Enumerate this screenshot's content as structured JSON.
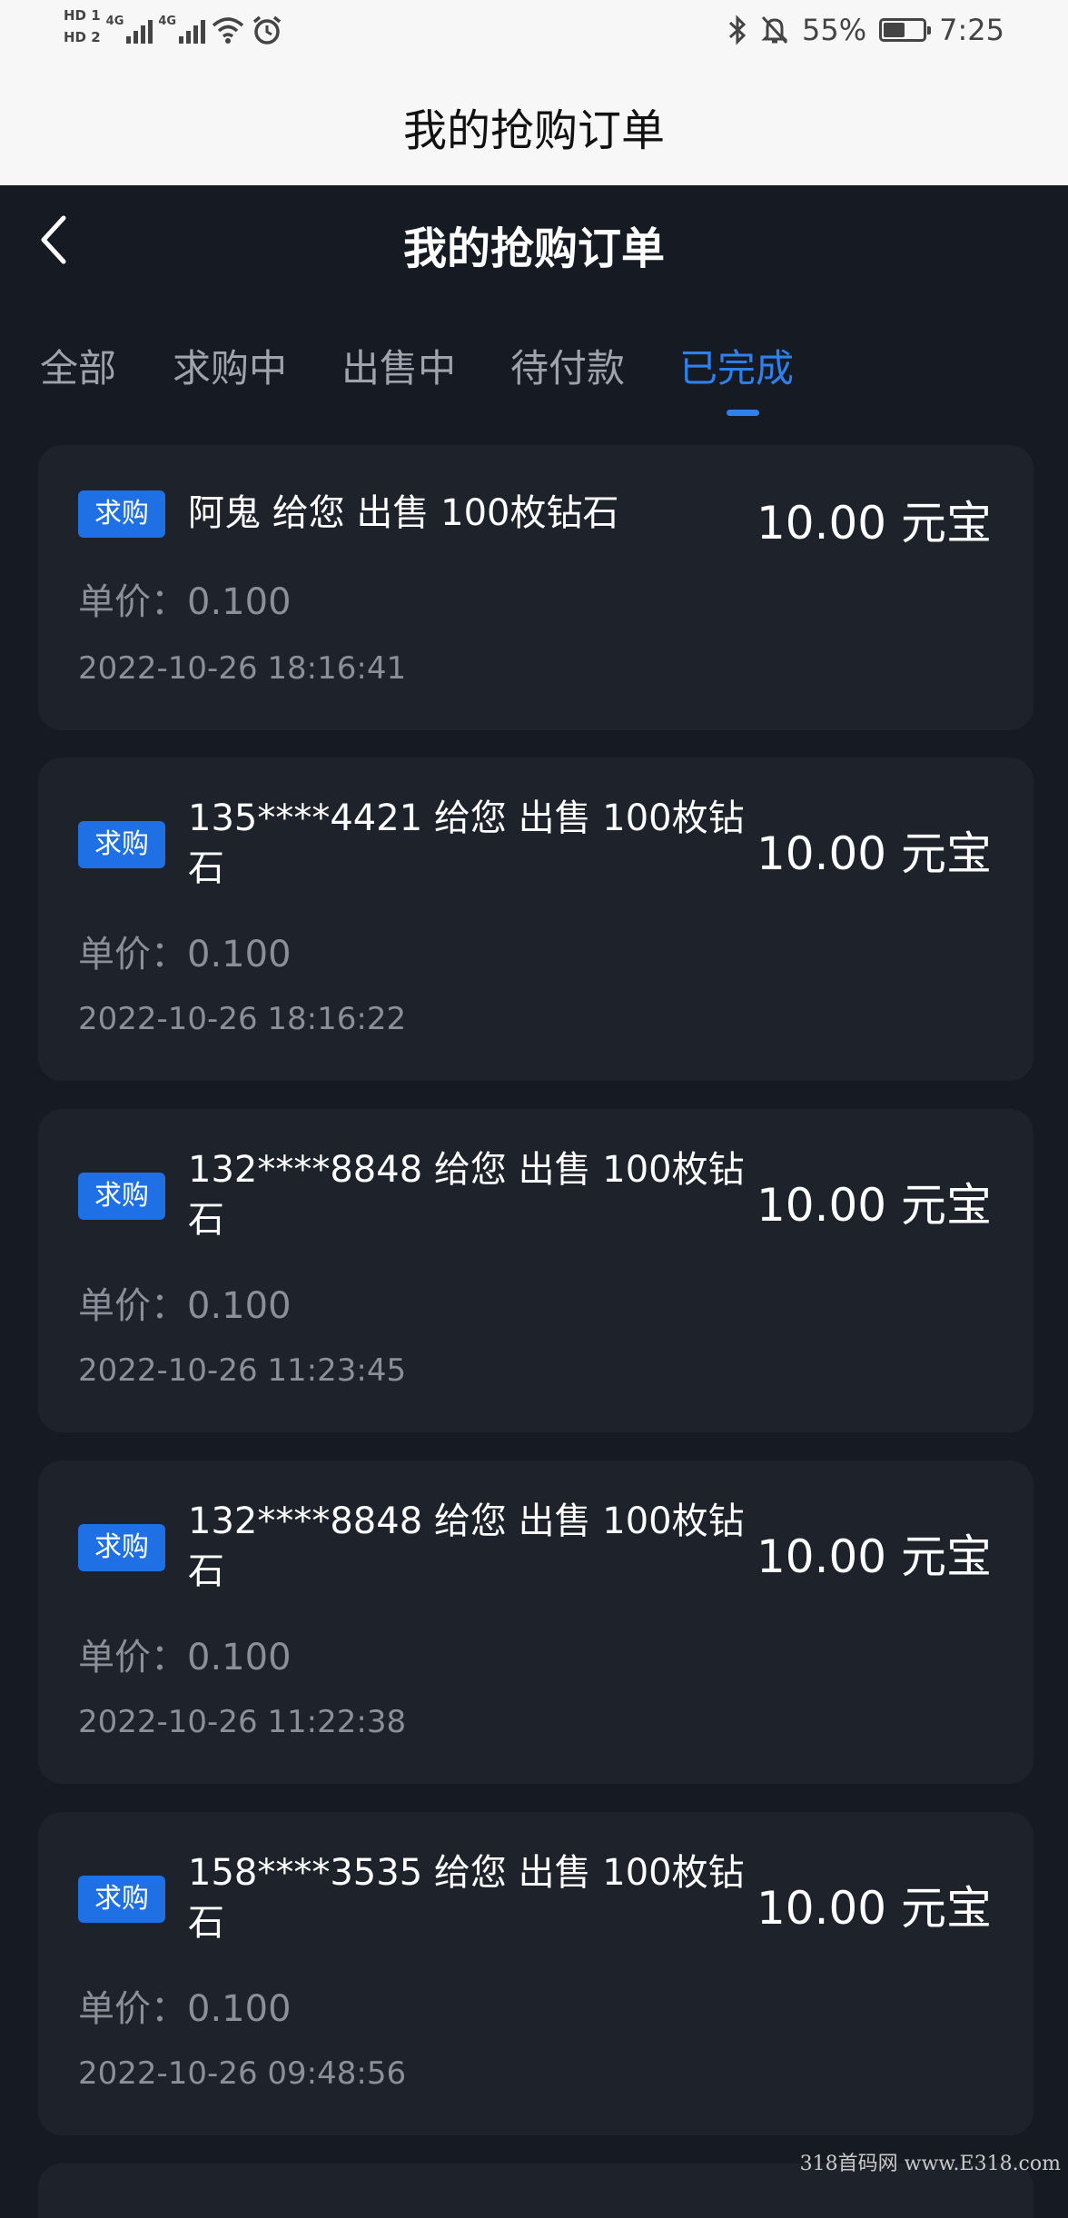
{
  "status_bar": {
    "hd1": "HD 1",
    "hd2": "HD 2",
    "net1": "4G",
    "net2": "4G",
    "battery_percent_text": "55%",
    "battery_level": 0.55,
    "time": "7:25"
  },
  "title_bar": {
    "title": "我的抢购订单"
  },
  "header": {
    "title": "我的抢购订单",
    "back_icon": "chevron-left-icon"
  },
  "tabs": [
    {
      "label": "全部",
      "active": false
    },
    {
      "label": "求购中",
      "active": false
    },
    {
      "label": "出售中",
      "active": false
    },
    {
      "label": "待付款",
      "active": false
    },
    {
      "label": "已完成",
      "active": true
    }
  ],
  "orders": [
    {
      "badge": "求购",
      "title": "阿鬼 给您 出售 100枚钻石",
      "amount": "10.00 元宝",
      "price_label": "单价：",
      "price": "0.100",
      "timestamp": "2022-10-26 18:16:41"
    },
    {
      "badge": "求购",
      "title": "135****4421 给您 出售 100枚钻石",
      "amount": "10.00 元宝",
      "price_label": "单价：",
      "price": "0.100",
      "timestamp": "2022-10-26 18:16:22"
    },
    {
      "badge": "求购",
      "title": "132****8848 给您 出售 100枚钻石",
      "amount": "10.00 元宝",
      "price_label": "单价：",
      "price": "0.100",
      "timestamp": "2022-10-26 11:23:45"
    },
    {
      "badge": "求购",
      "title": "132****8848 给您 出售 100枚钻石",
      "amount": "10.00 元宝",
      "price_label": "单价：",
      "price": "0.100",
      "timestamp": "2022-10-26 11:22:38"
    },
    {
      "badge": "求购",
      "title": "158****3535 给您 出售 100枚钻石",
      "amount": "10.00 元宝",
      "price_label": "单价：",
      "price": "0.100",
      "timestamp": "2022-10-26 09:48:56"
    }
  ],
  "watermark": "318首码网 www.E318.com",
  "colors": {
    "background": "#161a22",
    "card": "#1e222b",
    "accent": "#2f80ed",
    "badge": "#1f6fe5",
    "muted_text": "#8a8f99"
  }
}
